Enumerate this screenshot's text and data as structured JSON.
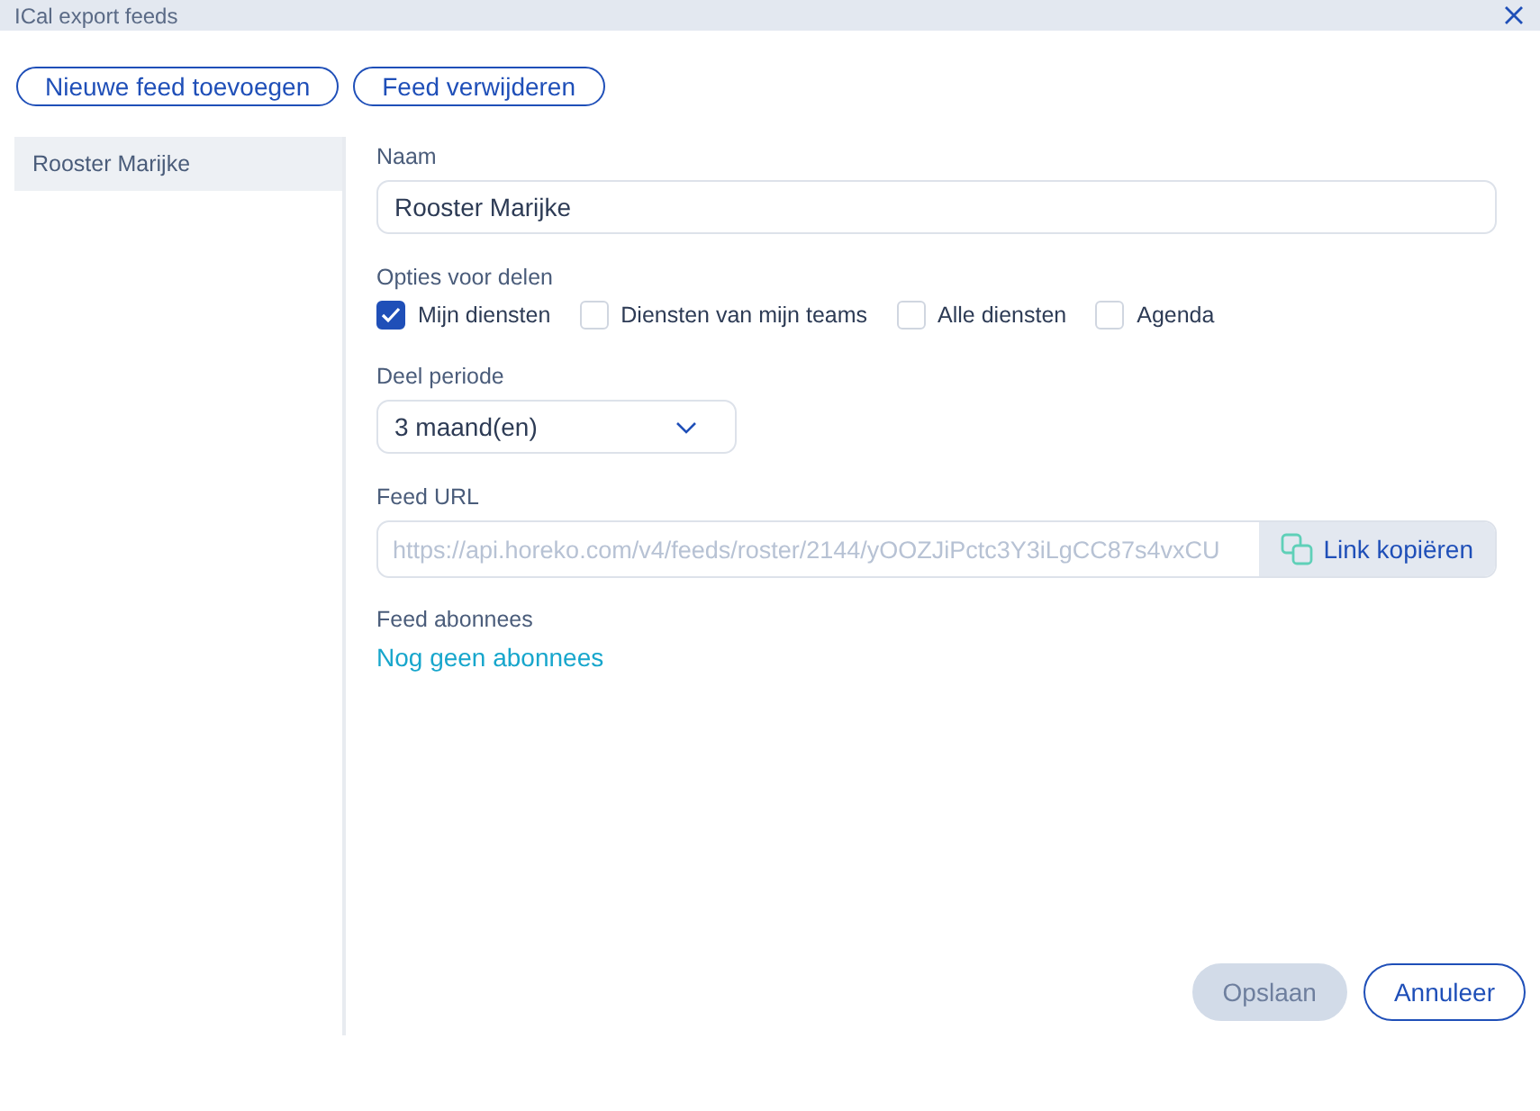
{
  "window": {
    "title": "ICal export feeds"
  },
  "toolbar": [
    "Nieuwe feed toevoegen",
    "Feed verwijderen"
  ],
  "sidebar": {
    "items": [
      {
        "label": "Rooster Marijke",
        "selected": true
      }
    ]
  },
  "form": {
    "name_label": "Naam",
    "name_value": "Rooster Marijke",
    "share_label": "Opties voor delen",
    "share_options": [
      {
        "label": "Mijn diensten",
        "checked": true
      },
      {
        "label": "Diensten van mijn teams",
        "checked": false
      },
      {
        "label": "Alle diensten",
        "checked": false
      },
      {
        "label": "Agenda",
        "checked": false
      }
    ],
    "period_label": "Deel periode",
    "period_value": "3 maand(en)",
    "url_label": "Feed URL",
    "url_value": "https://api.horeko.com/v4/feeds/roster/2144/yOOZJiPctc3Y3iLgCC87s4vxCU",
    "copy_button": "Link kopiëren",
    "subscribers_label": "Feed abonnees",
    "subscribers_empty": "Nog geen abonnees"
  },
  "footer": [
    {
      "label": "Opslaan",
      "disabled": true
    },
    {
      "label": "Annuleer",
      "disabled": false
    }
  ]
}
